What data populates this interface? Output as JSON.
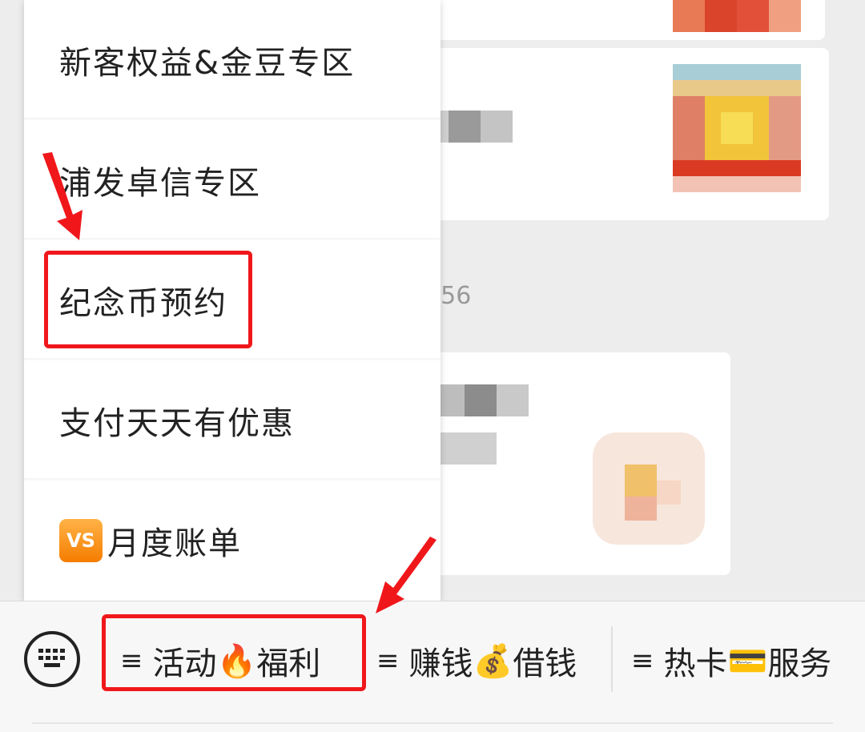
{
  "chat": {
    "timestamp_fragment": ":56"
  },
  "menu": {
    "items": [
      {
        "label": "新客权益&金豆专区"
      },
      {
        "label": "浦发卓信专区"
      },
      {
        "label": "纪念币预约"
      },
      {
        "label": "支付天天有优惠"
      },
      {
        "label": "月度账单",
        "icon_text": "VS",
        "icon": "vs-badge-icon"
      }
    ]
  },
  "bottom_bar": {
    "keyboard_icon": "keyboard-icon",
    "tabs": [
      {
        "prefix": "≡",
        "label_a": "活动",
        "emoji": "🔥",
        "label_b": "福利"
      },
      {
        "prefix": "≡",
        "label_a": "赚钱",
        "emoji": "💰",
        "label_b": "借钱"
      },
      {
        "prefix": "≡",
        "label_a": "热卡",
        "emoji": "💳",
        "label_b": "服务"
      }
    ]
  },
  "colors": {
    "highlight": "#f0171b",
    "arrow": "#f0171b"
  }
}
